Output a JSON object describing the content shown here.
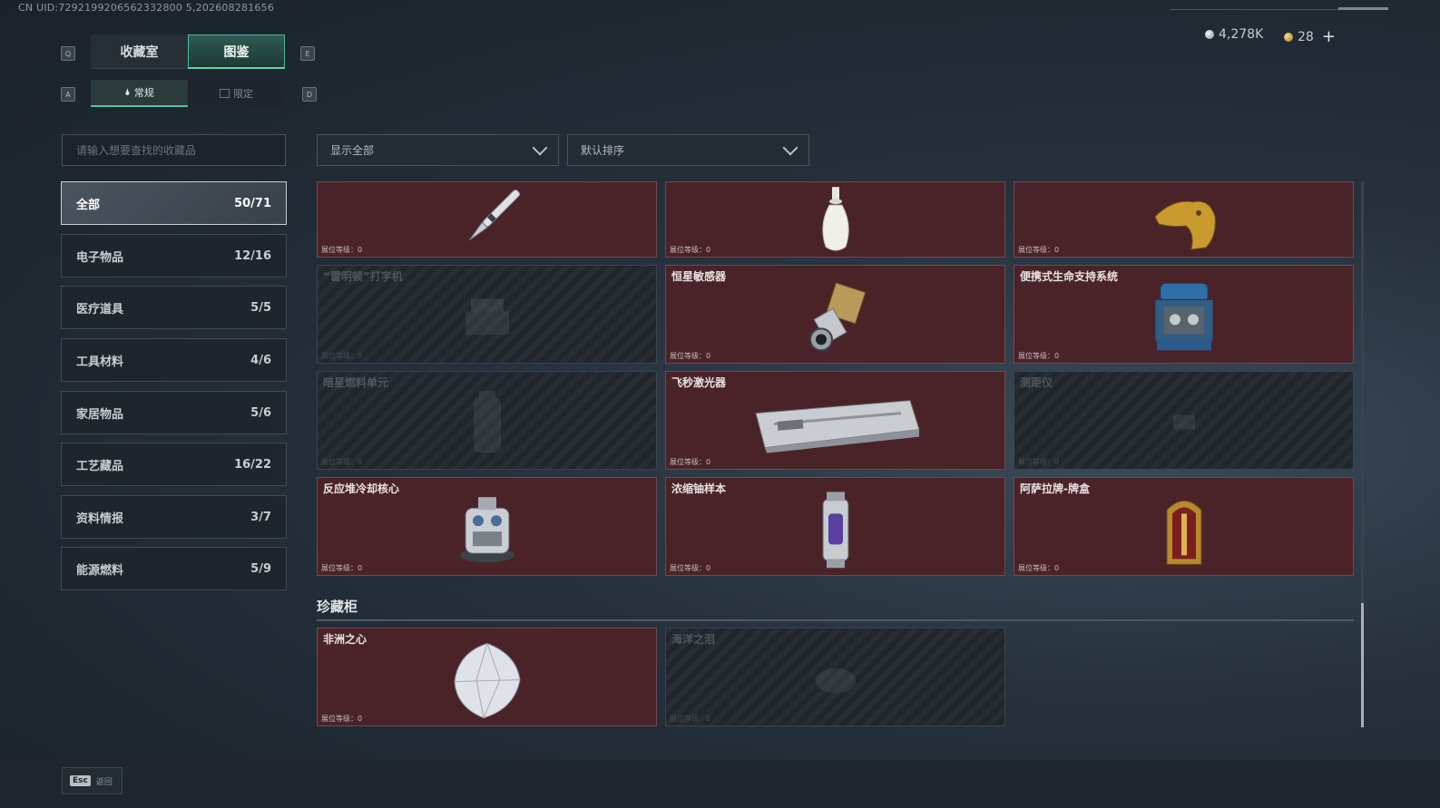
{
  "uid_text": "CN UID:7292199206562332800 5,202608281656",
  "currency": {
    "silver": "4,278K",
    "gold": "28",
    "add": "+"
  },
  "tabs": [
    {
      "label": "收藏室",
      "key": "Q"
    },
    {
      "label": "图鉴",
      "key": "E"
    }
  ],
  "subtabs": [
    {
      "label": "常规",
      "key": "A"
    },
    {
      "label": "限定",
      "key": "D"
    }
  ],
  "search": {
    "placeholder": "请输入想要查找的收藏品"
  },
  "filter": {
    "selected": "显示全部"
  },
  "sort": {
    "selected": "默认排序"
  },
  "categories": [
    {
      "label": "全部",
      "count": "50/71"
    },
    {
      "label": "电子物品",
      "count": "12/16"
    },
    {
      "label": "医疗道具",
      "count": "5/5"
    },
    {
      "label": "工具材料",
      "count": "4/6"
    },
    {
      "label": "家居物品",
      "count": "5/6"
    },
    {
      "label": "工艺藏品",
      "count": "16/22"
    },
    {
      "label": "资料情报",
      "count": "3/7"
    },
    {
      "label": "能源燃料",
      "count": "5/9"
    }
  ],
  "level_label": "展位等级：0",
  "items": [
    {
      "name": "",
      "icon": "fountain-pen-icon",
      "locked": false
    },
    {
      "name": "",
      "icon": "porcelain-vase-icon",
      "locked": false
    },
    {
      "name": "",
      "icon": "golden-horse-head-icon",
      "locked": false
    },
    {
      "name": "“雷明顿”打字机",
      "icon": "typewriter-icon",
      "locked": true
    },
    {
      "name": "恒星敏感器",
      "icon": "star-sensor-icon",
      "locked": false
    },
    {
      "name": "便携式生命支持系统",
      "icon": "life-support-system-icon",
      "locked": false
    },
    {
      "name": "暗星燃料单元",
      "icon": "fuel-cell-icon",
      "locked": true
    },
    {
      "name": "飞秒激光器",
      "icon": "laser-case-icon",
      "locked": false
    },
    {
      "name": "测距仪",
      "icon": "rangefinder-icon",
      "locked": true
    },
    {
      "name": "反应堆冷却核心",
      "icon": "reactor-core-icon",
      "locked": false
    },
    {
      "name": "浓缩铀样本",
      "icon": "uranium-canister-icon",
      "locked": false
    },
    {
      "name": "阿萨拉牌-牌盒",
      "icon": "card-box-icon",
      "locked": false
    }
  ],
  "cabinet": {
    "title": "珍藏柜",
    "items": [
      {
        "name": "非洲之心",
        "icon": "diamond-icon",
        "locked": false
      },
      {
        "name": "海洋之泪",
        "icon": "ocean-tear-icon",
        "locked": true
      }
    ]
  },
  "footer": {
    "key": "Esc",
    "label": "返回"
  },
  "colors": {
    "accent": "#4fc5a6",
    "card_owned": "#4a2329",
    "card_locked": "#262d33"
  }
}
